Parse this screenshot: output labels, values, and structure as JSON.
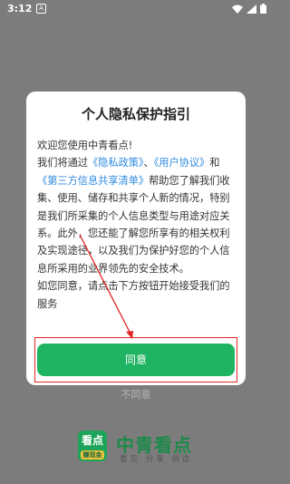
{
  "status_bar": {
    "time": "3:12",
    "app_icon_glyph": "A"
  },
  "dialog": {
    "title": "个人隐私保护指引",
    "body": {
      "greeting": "欢迎您使用中青看点!",
      "seg1": "我们将通过",
      "privacy_link": "《隐私政策》",
      "seg2": "、",
      "user_link": "《用户协议》",
      "seg3": "和",
      "third_party_link": "《第三方信息共享清单》",
      "seg4": "帮助您了解我们收集、使用、储存和共享个人新的情况，特别是我们所采集的个人信息类型与用途对应关系。此外，您还能了解您所享有的相关权利及实现途径，以及我们为保护好您的个人信息所采用的业界领先的安全技术。",
      "closing": "如您同意，请点击下方按钮开始接受我们的服务"
    },
    "agree_label": "同意",
    "disagree_label": "不同意"
  },
  "brand": {
    "logo_tile_text": "看点",
    "logo_tile_badge": "赚现金",
    "name": "中青看点",
    "slogan": "看见 分享 创造"
  },
  "colors": {
    "accent_green": "#1fb462",
    "link_blue": "#2f8be0",
    "annotation_red": "#e02424",
    "overlay_gray": "#7c7c7c"
  }
}
